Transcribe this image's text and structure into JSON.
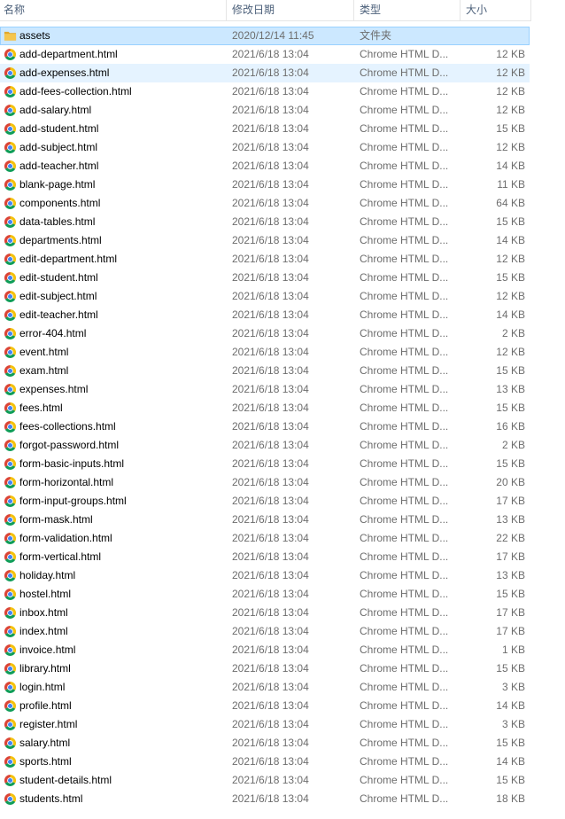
{
  "columns": {
    "name": "名称",
    "date": "修改日期",
    "type": "类型",
    "size": "大小"
  },
  "colors": {
    "selected_bg": "#cce8ff",
    "hover_bg": "#e5f3ff",
    "folder": "#f5c64f",
    "chrome_red": "#db4437",
    "chrome_yellow": "#f4c20d",
    "chrome_green": "#0f9d58",
    "chrome_blue": "#4285f4"
  },
  "files": [
    {
      "name": "assets",
      "date": "2020/12/14 11:45",
      "type": "文件夹",
      "size": "",
      "icon": "folder-icon",
      "state": "selected"
    },
    {
      "name": "add-department.html",
      "date": "2021/6/18 13:04",
      "type": "Chrome HTML D...",
      "size": "12 KB",
      "icon": "chrome-icon",
      "state": ""
    },
    {
      "name": "add-expenses.html",
      "date": "2021/6/18 13:04",
      "type": "Chrome HTML D...",
      "size": "12 KB",
      "icon": "chrome-icon",
      "state": "hover"
    },
    {
      "name": "add-fees-collection.html",
      "date": "2021/6/18 13:04",
      "type": "Chrome HTML D...",
      "size": "12 KB",
      "icon": "chrome-icon",
      "state": ""
    },
    {
      "name": "add-salary.html",
      "date": "2021/6/18 13:04",
      "type": "Chrome HTML D...",
      "size": "12 KB",
      "icon": "chrome-icon",
      "state": ""
    },
    {
      "name": "add-student.html",
      "date": "2021/6/18 13:04",
      "type": "Chrome HTML D...",
      "size": "15 KB",
      "icon": "chrome-icon",
      "state": ""
    },
    {
      "name": "add-subject.html",
      "date": "2021/6/18 13:04",
      "type": "Chrome HTML D...",
      "size": "12 KB",
      "icon": "chrome-icon",
      "state": ""
    },
    {
      "name": "add-teacher.html",
      "date": "2021/6/18 13:04",
      "type": "Chrome HTML D...",
      "size": "14 KB",
      "icon": "chrome-icon",
      "state": ""
    },
    {
      "name": "blank-page.html",
      "date": "2021/6/18 13:04",
      "type": "Chrome HTML D...",
      "size": "11 KB",
      "icon": "chrome-icon",
      "state": ""
    },
    {
      "name": "components.html",
      "date": "2021/6/18 13:04",
      "type": "Chrome HTML D...",
      "size": "64 KB",
      "icon": "chrome-icon",
      "state": ""
    },
    {
      "name": "data-tables.html",
      "date": "2021/6/18 13:04",
      "type": "Chrome HTML D...",
      "size": "15 KB",
      "icon": "chrome-icon",
      "state": ""
    },
    {
      "name": "departments.html",
      "date": "2021/6/18 13:04",
      "type": "Chrome HTML D...",
      "size": "14 KB",
      "icon": "chrome-icon",
      "state": ""
    },
    {
      "name": "edit-department.html",
      "date": "2021/6/18 13:04",
      "type": "Chrome HTML D...",
      "size": "12 KB",
      "icon": "chrome-icon",
      "state": ""
    },
    {
      "name": "edit-student.html",
      "date": "2021/6/18 13:04",
      "type": "Chrome HTML D...",
      "size": "15 KB",
      "icon": "chrome-icon",
      "state": ""
    },
    {
      "name": "edit-subject.html",
      "date": "2021/6/18 13:04",
      "type": "Chrome HTML D...",
      "size": "12 KB",
      "icon": "chrome-icon",
      "state": ""
    },
    {
      "name": "edit-teacher.html",
      "date": "2021/6/18 13:04",
      "type": "Chrome HTML D...",
      "size": "14 KB",
      "icon": "chrome-icon",
      "state": ""
    },
    {
      "name": "error-404.html",
      "date": "2021/6/18 13:04",
      "type": "Chrome HTML D...",
      "size": "2 KB",
      "icon": "chrome-icon",
      "state": ""
    },
    {
      "name": "event.html",
      "date": "2021/6/18 13:04",
      "type": "Chrome HTML D...",
      "size": "12 KB",
      "icon": "chrome-icon",
      "state": ""
    },
    {
      "name": "exam.html",
      "date": "2021/6/18 13:04",
      "type": "Chrome HTML D...",
      "size": "15 KB",
      "icon": "chrome-icon",
      "state": ""
    },
    {
      "name": "expenses.html",
      "date": "2021/6/18 13:04",
      "type": "Chrome HTML D...",
      "size": "13 KB",
      "icon": "chrome-icon",
      "state": ""
    },
    {
      "name": "fees.html",
      "date": "2021/6/18 13:04",
      "type": "Chrome HTML D...",
      "size": "15 KB",
      "icon": "chrome-icon",
      "state": ""
    },
    {
      "name": "fees-collections.html",
      "date": "2021/6/18 13:04",
      "type": "Chrome HTML D...",
      "size": "16 KB",
      "icon": "chrome-icon",
      "state": ""
    },
    {
      "name": "forgot-password.html",
      "date": "2021/6/18 13:04",
      "type": "Chrome HTML D...",
      "size": "2 KB",
      "icon": "chrome-icon",
      "state": ""
    },
    {
      "name": "form-basic-inputs.html",
      "date": "2021/6/18 13:04",
      "type": "Chrome HTML D...",
      "size": "15 KB",
      "icon": "chrome-icon",
      "state": ""
    },
    {
      "name": "form-horizontal.html",
      "date": "2021/6/18 13:04",
      "type": "Chrome HTML D...",
      "size": "20 KB",
      "icon": "chrome-icon",
      "state": ""
    },
    {
      "name": "form-input-groups.html",
      "date": "2021/6/18 13:04",
      "type": "Chrome HTML D...",
      "size": "17 KB",
      "icon": "chrome-icon",
      "state": ""
    },
    {
      "name": "form-mask.html",
      "date": "2021/6/18 13:04",
      "type": "Chrome HTML D...",
      "size": "13 KB",
      "icon": "chrome-icon",
      "state": ""
    },
    {
      "name": "form-validation.html",
      "date": "2021/6/18 13:04",
      "type": "Chrome HTML D...",
      "size": "22 KB",
      "icon": "chrome-icon",
      "state": ""
    },
    {
      "name": "form-vertical.html",
      "date": "2021/6/18 13:04",
      "type": "Chrome HTML D...",
      "size": "17 KB",
      "icon": "chrome-icon",
      "state": ""
    },
    {
      "name": "holiday.html",
      "date": "2021/6/18 13:04",
      "type": "Chrome HTML D...",
      "size": "13 KB",
      "icon": "chrome-icon",
      "state": ""
    },
    {
      "name": "hostel.html",
      "date": "2021/6/18 13:04",
      "type": "Chrome HTML D...",
      "size": "15 KB",
      "icon": "chrome-icon",
      "state": ""
    },
    {
      "name": "inbox.html",
      "date": "2021/6/18 13:04",
      "type": "Chrome HTML D...",
      "size": "17 KB",
      "icon": "chrome-icon",
      "state": ""
    },
    {
      "name": "index.html",
      "date": "2021/6/18 13:04",
      "type": "Chrome HTML D...",
      "size": "17 KB",
      "icon": "chrome-icon",
      "state": ""
    },
    {
      "name": "invoice.html",
      "date": "2021/6/18 13:04",
      "type": "Chrome HTML D...",
      "size": "1 KB",
      "icon": "chrome-icon",
      "state": ""
    },
    {
      "name": "library.html",
      "date": "2021/6/18 13:04",
      "type": "Chrome HTML D...",
      "size": "15 KB",
      "icon": "chrome-icon",
      "state": ""
    },
    {
      "name": "login.html",
      "date": "2021/6/18 13:04",
      "type": "Chrome HTML D...",
      "size": "3 KB",
      "icon": "chrome-icon",
      "state": ""
    },
    {
      "name": "profile.html",
      "date": "2021/6/18 13:04",
      "type": "Chrome HTML D...",
      "size": "14 KB",
      "icon": "chrome-icon",
      "state": ""
    },
    {
      "name": "register.html",
      "date": "2021/6/18 13:04",
      "type": "Chrome HTML D...",
      "size": "3 KB",
      "icon": "chrome-icon",
      "state": ""
    },
    {
      "name": "salary.html",
      "date": "2021/6/18 13:04",
      "type": "Chrome HTML D...",
      "size": "15 KB",
      "icon": "chrome-icon",
      "state": ""
    },
    {
      "name": "sports.html",
      "date": "2021/6/18 13:04",
      "type": "Chrome HTML D...",
      "size": "14 KB",
      "icon": "chrome-icon",
      "state": ""
    },
    {
      "name": "student-details.html",
      "date": "2021/6/18 13:04",
      "type": "Chrome HTML D...",
      "size": "15 KB",
      "icon": "chrome-icon",
      "state": ""
    },
    {
      "name": "students.html",
      "date": "2021/6/18 13:04",
      "type": "Chrome HTML D...",
      "size": "18 KB",
      "icon": "chrome-icon",
      "state": ""
    }
  ]
}
